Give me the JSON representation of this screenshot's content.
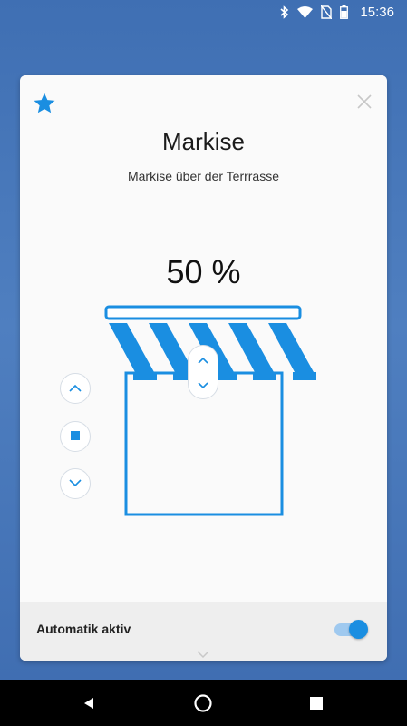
{
  "status_bar": {
    "time": "15:36",
    "icons": [
      "bluetooth-icon",
      "wifi-icon",
      "no-sim-icon",
      "battery-icon"
    ]
  },
  "card": {
    "title": "Markise",
    "subtitle": "Markise über der Terrrasse",
    "position_text": "50 %",
    "position_value_percent": 50,
    "favorite": true,
    "controls": [
      "up-arrow-icon",
      "stop-icon",
      "down-arrow-icon"
    ],
    "footer": {
      "automatic_label": "Automatik aktiv",
      "automatic_enabled": true
    }
  },
  "nav_bar": {
    "buttons": [
      "back-icon",
      "home-icon",
      "recents-icon"
    ]
  },
  "colors": {
    "accent": "#1a8ee1",
    "background": "#4a79bb",
    "card": "#fafafa",
    "footer": "#eeeeee"
  }
}
